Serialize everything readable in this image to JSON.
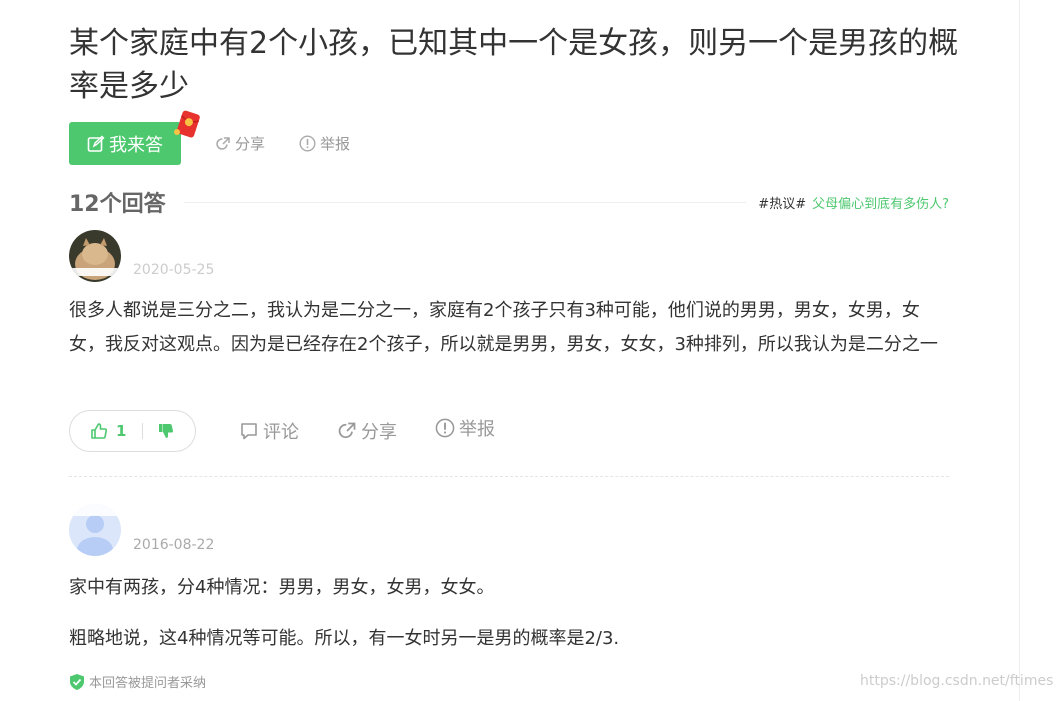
{
  "question": {
    "title": "某个家庭中有2个小孩，已知其中一个是女孩，则另一个是男孩的概率是多少",
    "answer_button": "我来答",
    "share": "分享",
    "report": "举报"
  },
  "answers_header": {
    "count": "12个回答",
    "hot_tag": "#热议#",
    "hot_link": "父母偏心到底有多伤人?"
  },
  "answers": [
    {
      "date": "2020-05-25",
      "text": "很多人都说是三分之二，我认为是二分之一，家庭有2个孩子只有3种可能，他们说的男男，男女，女男，女女，我反对这观点。因为是已经存在2个孩子，所以就是男男，男女，女女，3种排列，所以我认为是二分之一",
      "likes": "1",
      "comment": "评论",
      "share": "分享",
      "report": "举报"
    },
    {
      "date": "2016-08-22",
      "paragraph1": "家中有两孩，分4种情况：男男，男女，女男，女女。",
      "paragraph2": "粗略地说，这4种情况等可能。所以，有一女时另一是男的概率是2/3.",
      "adopted": "本回答被提问者采纳"
    }
  ],
  "watermark": "https://blog.csdn.net/ftimes",
  "colors": {
    "accent": "#4dc86f",
    "muted": "#999999"
  }
}
